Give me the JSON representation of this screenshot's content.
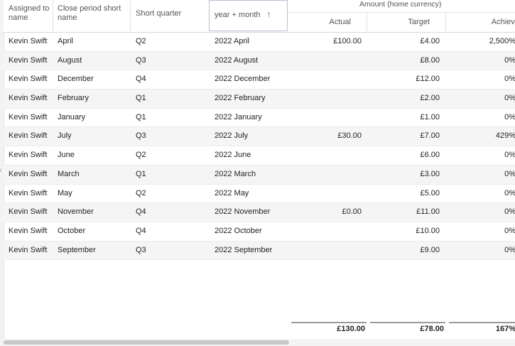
{
  "columns": {
    "assigned": "Assigned to name",
    "close_period": "Close period short name",
    "short_quarter": "Short quarter",
    "year_month": "year + month",
    "amount_group": "Amount (home currency)",
    "actual": "Actual",
    "target": "Target",
    "achieved": "Achieved"
  },
  "sort_icon": "arrow-up-icon",
  "rows": [
    {
      "name": "Kevin Swift",
      "close": "April",
      "quarter": "Q2",
      "month": "2022 April",
      "actual": "£100.00",
      "target": "£4.00",
      "achieved": "2,500%"
    },
    {
      "name": "Kevin Swift",
      "close": "August",
      "quarter": "Q3",
      "month": "2022 August",
      "actual": "",
      "target": "£8.00",
      "achieved": "0%"
    },
    {
      "name": "Kevin Swift",
      "close": "December",
      "quarter": "Q4",
      "month": "2022 December",
      "actual": "",
      "target": "£12.00",
      "achieved": "0%"
    },
    {
      "name": "Kevin Swift",
      "close": "February",
      "quarter": "Q1",
      "month": "2022 February",
      "actual": "",
      "target": "£2.00",
      "achieved": "0%"
    },
    {
      "name": "Kevin Swift",
      "close": "January",
      "quarter": "Q1",
      "month": "2022 January",
      "actual": "",
      "target": "£1.00",
      "achieved": "0%"
    },
    {
      "name": "Kevin Swift",
      "close": "July",
      "quarter": "Q3",
      "month": "2022 July",
      "actual": "£30.00",
      "target": "£7.00",
      "achieved": "429%"
    },
    {
      "name": "Kevin Swift",
      "close": "June",
      "quarter": "Q2",
      "month": "2022 June",
      "actual": "",
      "target": "£6.00",
      "achieved": "0%"
    },
    {
      "name": "Kevin Swift",
      "close": "March",
      "quarter": "Q1",
      "month": "2022 March",
      "actual": "",
      "target": "£3.00",
      "achieved": "0%"
    },
    {
      "name": "Kevin Swift",
      "close": "May",
      "quarter": "Q2",
      "month": "2022 May",
      "actual": "",
      "target": "£5.00",
      "achieved": "0%"
    },
    {
      "name": "Kevin Swift",
      "close": "November",
      "quarter": "Q4",
      "month": "2022 November",
      "actual": "£0.00",
      "target": "£11.00",
      "achieved": "0%"
    },
    {
      "name": "Kevin Swift",
      "close": "October",
      "quarter": "Q4",
      "month": "2022 October",
      "actual": "",
      "target": "£10.00",
      "achieved": "0%"
    },
    {
      "name": "Kevin Swift",
      "close": "September",
      "quarter": "Q3",
      "month": "2022 September",
      "actual": "",
      "target": "£9.00",
      "achieved": "0%"
    }
  ],
  "totals": {
    "actual": "£130.00",
    "target": "£78.00",
    "achieved": "167%"
  },
  "scroll_icon": "chevron-left-icon"
}
